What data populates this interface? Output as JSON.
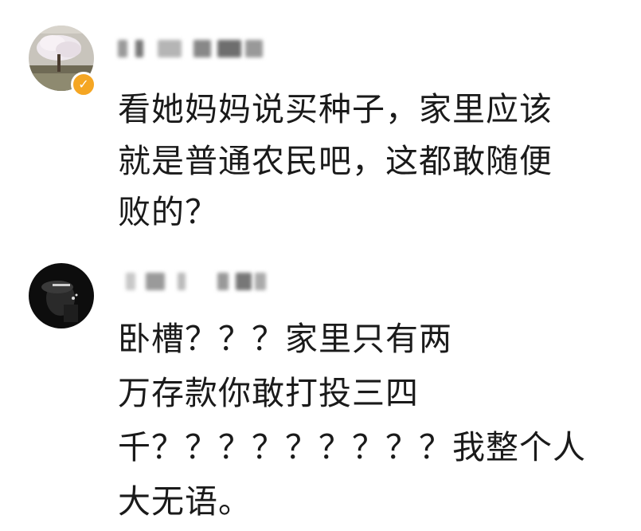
{
  "comments": [
    {
      "avatar": "tree-landscape-avatar",
      "verified": true,
      "badge_icon": "verified-badge-icon",
      "lines": [
        "看她妈妈说买种子，家里应该",
        "就是普通农民吧，这都敢随便",
        "败的？"
      ]
    },
    {
      "avatar": "dark-portrait-avatar",
      "verified": false,
      "lines": [
        "卧槽？？？家里只有两",
        "万存款你敢打投三四",
        "千？？？？？？？？？我整个人",
        "大无语。"
      ]
    }
  ],
  "colors": {
    "text": "#1a1a1a",
    "badge": "#f5a623",
    "blurred_name": "#9a9a9a"
  }
}
